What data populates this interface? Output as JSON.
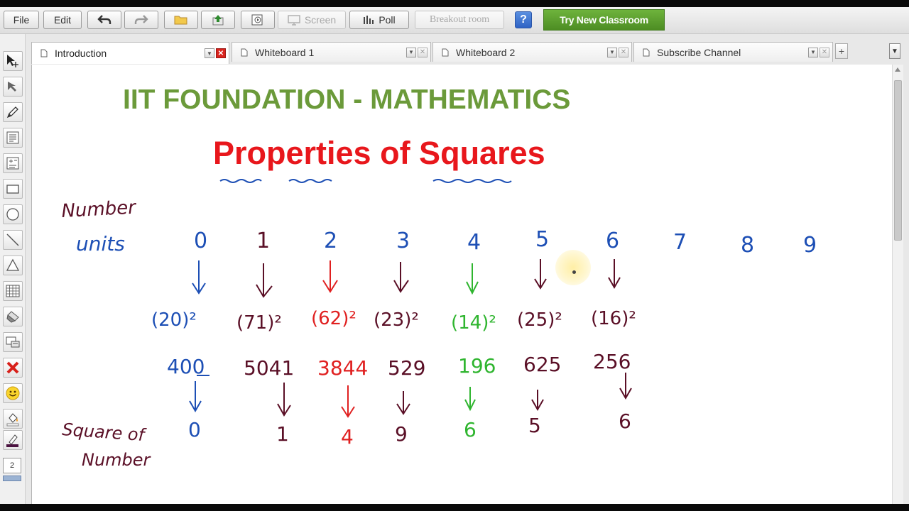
{
  "toolbar": {
    "file_label": "File",
    "edit_label": "Edit",
    "screen_label": "Screen",
    "poll_label": "Poll",
    "breakout_label": "Breakout room",
    "help_label": "?",
    "try_label": "Try New Classroom"
  },
  "tabs": [
    {
      "label": "Introduction",
      "active": true
    },
    {
      "label": "Whiteboard 1",
      "active": false
    },
    {
      "label": "Whiteboard 2",
      "active": false
    },
    {
      "label": "Subscribe Channel",
      "active": false
    }
  ],
  "tab_add_label": "+",
  "tab_menu_label": "▼",
  "left_tools": {
    "stroke_size": "2",
    "icons": [
      "select-move-icon",
      "pointer-arrow-icon",
      "pen-icon",
      "text-box-icon",
      "equation-icon",
      "rectangle-icon",
      "circle-icon",
      "line-icon",
      "triangle-icon",
      "table-icon",
      "eraser-icon",
      "clear-screen-icon",
      "delete-icon",
      "emoticon-icon",
      "fill-color-icon",
      "stroke-color-icon"
    ]
  },
  "canvas": {
    "title": "IIT FOUNDATION - MATHEMATICS",
    "subtitle": "Properties of Squares",
    "notes": {
      "row_label_1": "Number",
      "row_label_2": "units",
      "units": [
        "0",
        "1",
        "2",
        "3",
        "4",
        "5",
        "6",
        "7",
        "8",
        "9"
      ],
      "examples": [
        "(20)²",
        "(71)²",
        "(62)²",
        "(23)²",
        "(14)²",
        "(25)²",
        "(16)²"
      ],
      "squares": [
        "400",
        "5041",
        "3844",
        "529",
        "196",
        "625",
        "256"
      ],
      "bottom_label_1": "Square of",
      "bottom_label_2": "Number",
      "result_units": [
        "0",
        "1",
        "4",
        "9",
        "6",
        "5",
        "6"
      ]
    }
  },
  "colors": {
    "title_green": "#6b9a3a",
    "subtitle_red": "#e8171c",
    "ink_blue": "#1d4fb5",
    "ink_maroon": "#5a0f26",
    "ink_red": "#e02020",
    "ink_green": "#2fb52f",
    "try_button_green": "#5a9e2d"
  }
}
